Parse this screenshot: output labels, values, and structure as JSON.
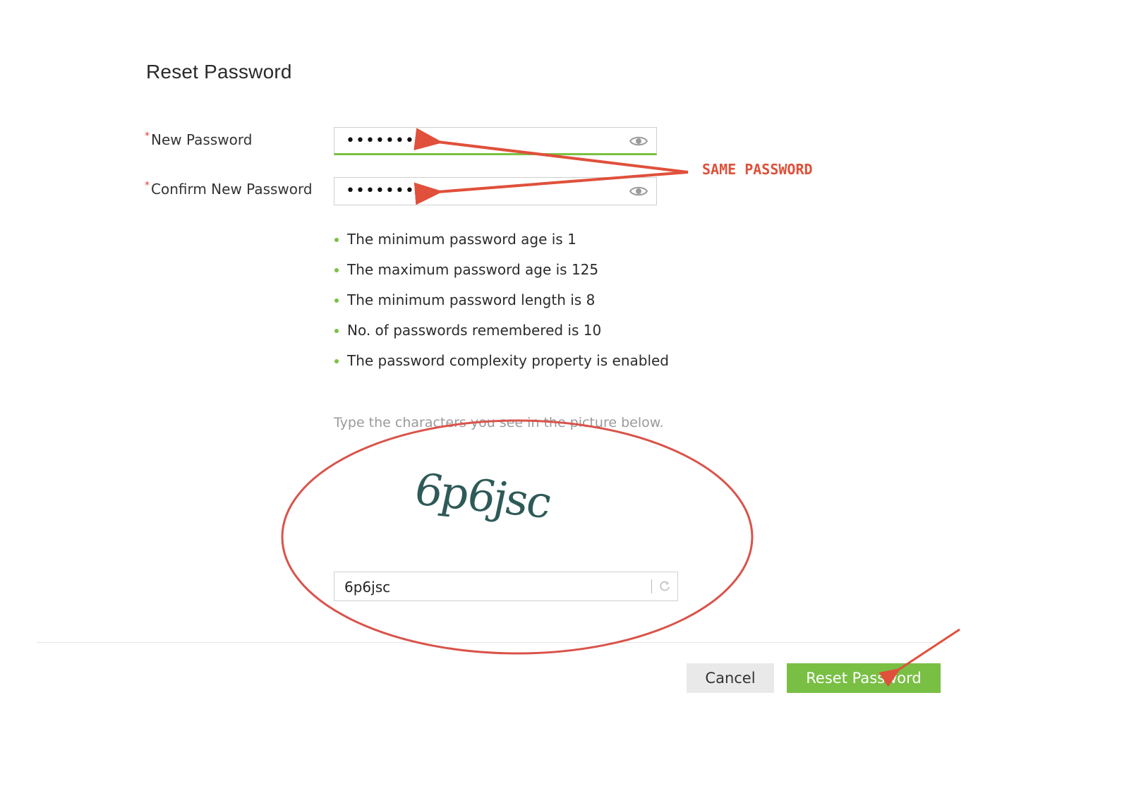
{
  "page": {
    "title": "Reset Password"
  },
  "form": {
    "required_marker": "*",
    "new_password": {
      "label": "New Password",
      "value": "•••••••••"
    },
    "confirm_password": {
      "label": "Confirm New Password",
      "value": "•••••••••"
    }
  },
  "rules": [
    "The minimum password age is 1",
    "The maximum password age is 125",
    "The minimum password length is 8",
    "No. of passwords remembered is 10",
    "The password complexity property is enabled"
  ],
  "captcha": {
    "hint": "Type the characters you see in the picture below.",
    "image_text": "6p6jsc",
    "input_value": "6p6jsc"
  },
  "actions": {
    "cancel_label": "Cancel",
    "submit_label": "Reset Password"
  },
  "annotation": {
    "label": "SAME PASSWORD",
    "color": "#e0503a"
  },
  "colors": {
    "accent": "#79bf44",
    "annotation": "#e0503a"
  },
  "icons": {
    "show_password": "eye-icon",
    "refresh_captcha": "refresh-icon"
  }
}
